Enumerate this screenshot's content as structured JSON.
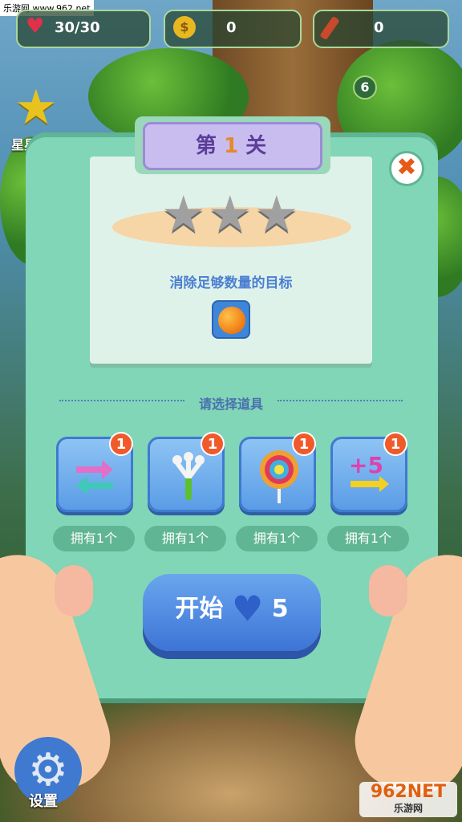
{
  "watermark": "乐游网 www.962.net",
  "top_bar": {
    "lives": "30/30",
    "coins": "0",
    "items": "0"
  },
  "sidebar": {
    "star_label": "星星",
    "badge": "6"
  },
  "level_dialog": {
    "title_prefix": "第",
    "level_number": "1",
    "title_suffix": "关",
    "stars_earned": 0,
    "stars_total": 3,
    "goal_text": "消除足够数量的目标",
    "goal_icon": "orange-icon",
    "select_label": "请选择道具",
    "boosters": [
      {
        "icon": "swap-arrows-icon",
        "count": "1",
        "owned": "拥有1个"
      },
      {
        "icon": "fork-icon",
        "count": "1",
        "owned": "拥有1个"
      },
      {
        "icon": "lollipop-icon",
        "count": "1",
        "owned": "拥有1个"
      },
      {
        "icon": "plus5-moves-icon",
        "count": "1",
        "owned": "拥有1个"
      }
    ],
    "start_label": "开始",
    "start_cost": "5"
  },
  "bottom": {
    "settings_label": "设置",
    "logo_text": "962NET",
    "logo_sub": "乐游网"
  },
  "colors": {
    "panel": "#80d6b6",
    "title_box": "#c9bdf0",
    "start_button": "#3d74d6",
    "badge": "#f05a2a"
  }
}
